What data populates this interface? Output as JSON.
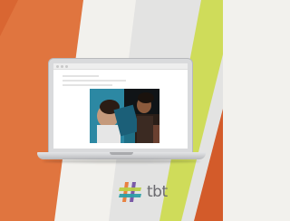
{
  "colors": {
    "background": "#f2f1ed",
    "orange": "#e0753f",
    "dark_orange": "#d35b2a",
    "lime": "#cfdc5a",
    "grey_band": "#e3e3e2",
    "logo_text": "#6b6a6f",
    "hash_orange": "#e8813f",
    "hash_purple": "#7a5aa6",
    "hash_lime": "#b9cf45",
    "hash_teal": "#2e9fa8"
  },
  "laptop": {
    "photo_description_icon": "classroom-photo"
  },
  "logo": {
    "text": "tbt",
    "icon": "hashtag-logo-icon"
  }
}
